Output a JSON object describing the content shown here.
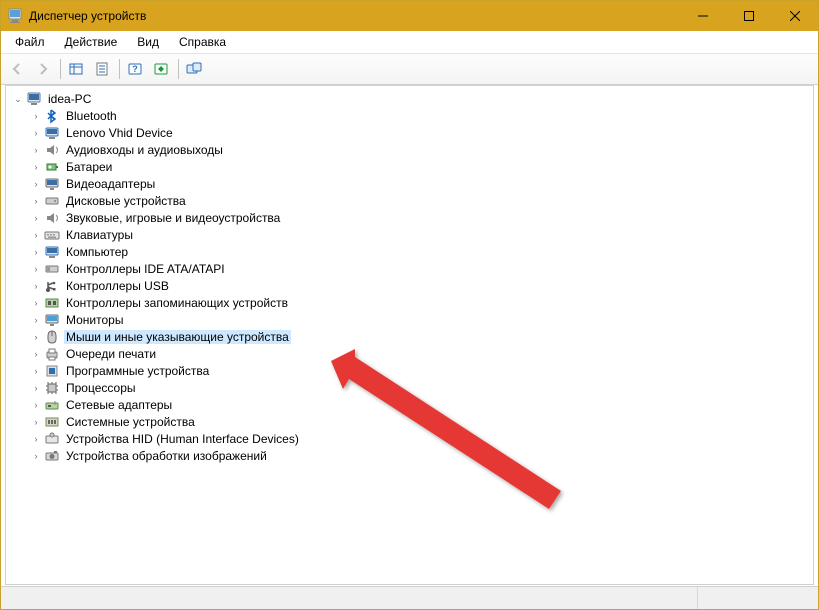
{
  "window": {
    "title": "Диспетчер устройств"
  },
  "menu": {
    "file": "Файл",
    "action": "Действие",
    "view": "Вид",
    "help": "Справка"
  },
  "tree": {
    "root": "idea-PC",
    "nodes": [
      {
        "id": "bluetooth",
        "label": "Bluetooth"
      },
      {
        "id": "lenovo-vhid",
        "label": "Lenovo Vhid Device"
      },
      {
        "id": "audio-io",
        "label": "Аудиовходы и аудиовыходы"
      },
      {
        "id": "batteries",
        "label": "Батареи"
      },
      {
        "id": "display",
        "label": "Видеоадаптеры"
      },
      {
        "id": "disk",
        "label": "Дисковые устройства"
      },
      {
        "id": "sound-game",
        "label": "Звуковые, игровые и видеоустройства"
      },
      {
        "id": "keyboards",
        "label": "Клавиатуры"
      },
      {
        "id": "computer",
        "label": "Компьютер"
      },
      {
        "id": "ide-atapi",
        "label": "Контроллеры IDE ATA/ATAPI"
      },
      {
        "id": "usb",
        "label": "Контроллеры USB"
      },
      {
        "id": "storage-ctl",
        "label": "Контроллеры запоминающих устройств"
      },
      {
        "id": "monitors",
        "label": "Мониторы"
      },
      {
        "id": "mice",
        "label": "Мыши и иные указывающие устройства",
        "selected": true
      },
      {
        "id": "print-queues",
        "label": "Очереди печати"
      },
      {
        "id": "software-dev",
        "label": "Программные устройства"
      },
      {
        "id": "processors",
        "label": "Процессоры"
      },
      {
        "id": "network",
        "label": "Сетевые адаптеры"
      },
      {
        "id": "system",
        "label": "Системные устройства"
      },
      {
        "id": "hid",
        "label": "Устройства HID (Human Interface Devices)"
      },
      {
        "id": "imaging",
        "label": "Устройства обработки изображений"
      }
    ]
  }
}
